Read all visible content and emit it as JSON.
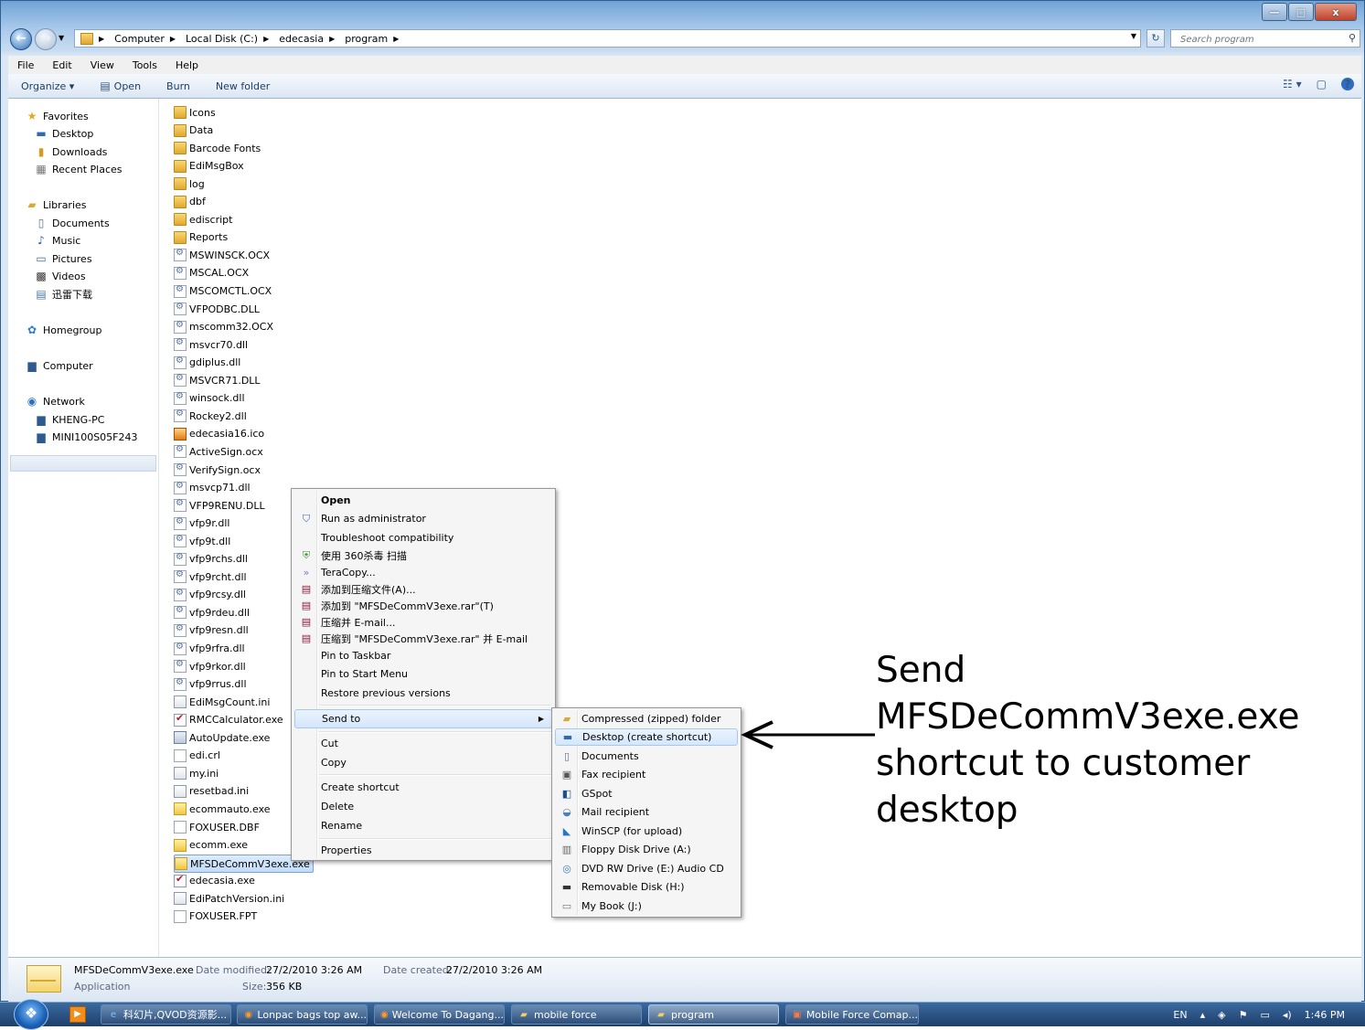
{
  "window": {
    "controls": {
      "minimize": "—",
      "maximize": "□",
      "close": "x"
    }
  },
  "address": {
    "crumbs": [
      "Computer",
      "Local Disk (C:)",
      "edecasia",
      "program"
    ],
    "search_placeholder": "Search program"
  },
  "menubar": [
    "File",
    "Edit",
    "View",
    "Tools",
    "Help"
  ],
  "commandbar": {
    "organize": "Organize ▾",
    "open": "Open",
    "burn": "Burn",
    "new_folder": "New folder"
  },
  "navpane": {
    "favorites": "Favorites",
    "desktop": "Desktop",
    "downloads": "Downloads",
    "recent": "Recent Places",
    "libraries": "Libraries",
    "documents": "Documents",
    "music": "Music",
    "pictures": "Pictures",
    "videos": "Videos",
    "xunlei": "迅雷下载",
    "homegroup": "Homegroup",
    "computer": "Computer",
    "network": "Network",
    "kheng": "KHENG-PC",
    "mini": "MINI100S05F243"
  },
  "files": [
    {
      "name": "Icons",
      "icon": "folder"
    },
    {
      "name": "Data",
      "icon": "folder"
    },
    {
      "name": "Barcode Fonts",
      "icon": "folder"
    },
    {
      "name": "EdiMsgBox",
      "icon": "folder"
    },
    {
      "name": "log",
      "icon": "folder"
    },
    {
      "name": "dbf",
      "icon": "folder"
    },
    {
      "name": "ediscript",
      "icon": "folder"
    },
    {
      "name": "Reports",
      "icon": "folder"
    },
    {
      "name": "MSWINSCK.OCX",
      "icon": "dll"
    },
    {
      "name": "MSCAL.OCX",
      "icon": "dll"
    },
    {
      "name": "MSCOMCTL.OCX",
      "icon": "dll"
    },
    {
      "name": "VFPODBC.DLL",
      "icon": "dll"
    },
    {
      "name": "mscomm32.OCX",
      "icon": "dll"
    },
    {
      "name": "msvcr70.dll",
      "icon": "dll"
    },
    {
      "name": "gdiplus.dll",
      "icon": "dll"
    },
    {
      "name": "MSVCR71.DLL",
      "icon": "dll"
    },
    {
      "name": "winsock.dll",
      "icon": "dll"
    },
    {
      "name": "Rockey2.dll",
      "icon": "dll"
    },
    {
      "name": "edecasia16.ico",
      "icon": "ico"
    },
    {
      "name": "ActiveSign.ocx",
      "icon": "dll"
    },
    {
      "name": "VerifySign.ocx",
      "icon": "dll"
    },
    {
      "name": "msvcp71.dll",
      "icon": "dll"
    },
    {
      "name": "VFP9RENU.DLL",
      "icon": "dll"
    },
    {
      "name": "vfp9r.dll",
      "icon": "dll"
    },
    {
      "name": "vfp9t.dll",
      "icon": "dll"
    },
    {
      "name": "vfp9rchs.dll",
      "icon": "dll"
    },
    {
      "name": "vfp9rcht.dll",
      "icon": "dll"
    },
    {
      "name": "vfp9rcsy.dll",
      "icon": "dll"
    },
    {
      "name": "vfp9rdeu.dll",
      "icon": "dll"
    },
    {
      "name": "vfp9resn.dll",
      "icon": "dll"
    },
    {
      "name": "vfp9rfra.dll",
      "icon": "dll"
    },
    {
      "name": "vfp9rkor.dll",
      "icon": "dll"
    },
    {
      "name": "vfp9rrus.dll",
      "icon": "dll"
    },
    {
      "name": "EdiMsgCount.ini",
      "icon": "ini"
    },
    {
      "name": "RMCCalculator.exe",
      "icon": "exe-red"
    },
    {
      "name": "AutoUpdate.exe",
      "icon": "exe"
    },
    {
      "name": "edi.crl",
      "icon": "txt"
    },
    {
      "name": "my.ini",
      "icon": "ini"
    },
    {
      "name": "resetbad.ini",
      "icon": "ini"
    },
    {
      "name": "ecommauto.exe",
      "icon": "yellow"
    },
    {
      "name": "FOXUSER.DBF",
      "icon": "txt"
    },
    {
      "name": "ecomm.exe",
      "icon": "yellow"
    },
    {
      "name": "MFSDeCommV3exe.exe",
      "icon": "yellow"
    },
    {
      "name": "edecasia.exe",
      "icon": "exe-red"
    },
    {
      "name": "EdiPatchVersion.ini",
      "icon": "ini"
    },
    {
      "name": "FOXUSER.FPT",
      "icon": "txt"
    }
  ],
  "context_menu": {
    "open": "Open",
    "run_admin": "Run as administrator",
    "troubleshoot": "Troubleshoot compatibility",
    "scan360": "使用 360杀毒 扫描",
    "teracopy": "TeraCopy...",
    "rar_add": "添加到压缩文件(A)...",
    "rar_add_named": "添加到 \"MFSDeCommV3exe.rar\"(T)",
    "rar_email": "压缩并 E-mail...",
    "rar_named_email": "压缩到 \"MFSDeCommV3exe.rar\" 并 E-mail",
    "pin_taskbar": "Pin to Taskbar",
    "pin_start": "Pin to Start Menu",
    "restore": "Restore previous versions",
    "send_to": "Send to",
    "cut": "Cut",
    "copy": "Copy",
    "create_shortcut": "Create shortcut",
    "delete": "Delete",
    "rename": "Rename",
    "properties": "Properties"
  },
  "send_to_menu": [
    "Compressed (zipped) folder",
    "Desktop (create shortcut)",
    "Documents",
    "Fax recipient",
    "GSpot",
    "Mail recipient",
    "WinSCP (for upload)",
    "Floppy Disk Drive (A:)",
    "DVD RW Drive (E:) Audio CD",
    "Removable Disk (H:)",
    "My Book (J:)"
  ],
  "details": {
    "filename": "MFSDeCommV3exe.exe",
    "type": "Application",
    "modified_label": "Date modified:",
    "modified_value": "27/2/2010 3:26 AM",
    "created_label": "Date created:",
    "created_value": "27/2/2010 3:26 AM",
    "size_label": "Size:",
    "size_value": "356 KB"
  },
  "taskbar": {
    "items": [
      "科幻片,QVOD资源影...",
      "Lonpac bags top aw...",
      "Welcome To Dagang...",
      "mobile force",
      "program",
      "Mobile Force Comap..."
    ],
    "lang": "EN",
    "time": "1:46 PM"
  },
  "annotation": "Send\nMFSDeCommV3exe.exe\nshortcut to customer\ndesktop"
}
